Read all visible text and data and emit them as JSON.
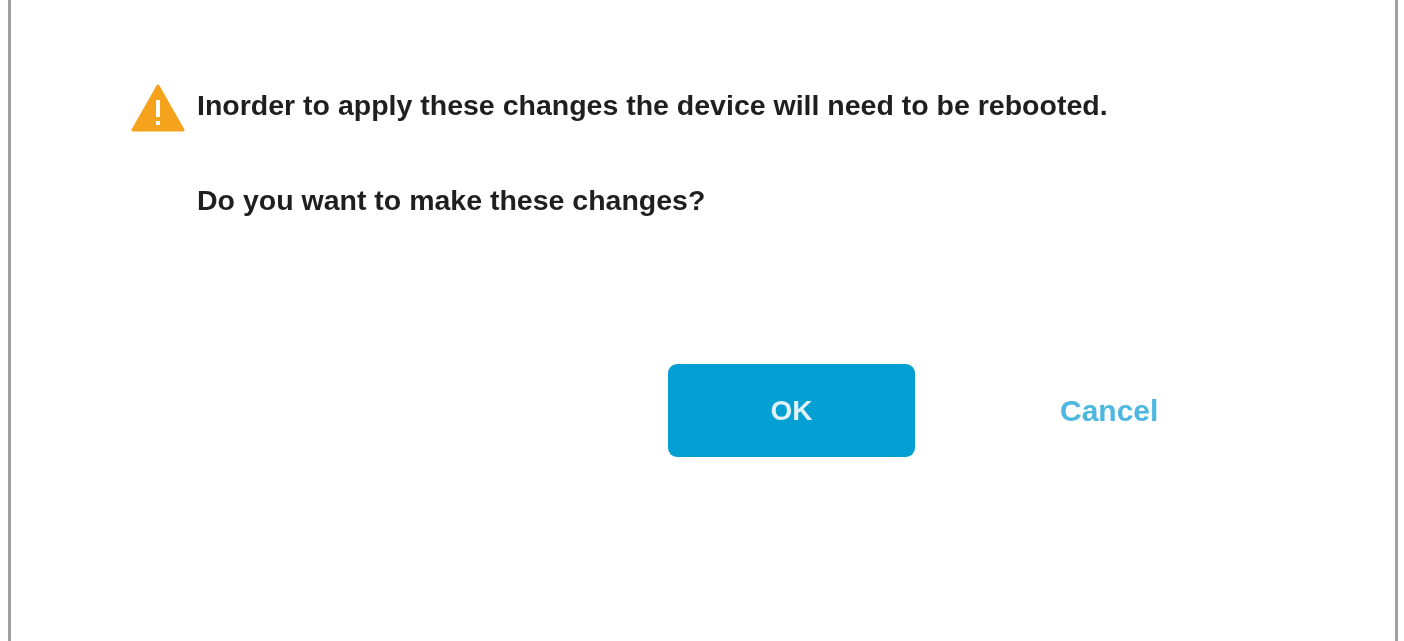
{
  "dialog": {
    "message": "Inorder to apply these changes the device will need to be rebooted.",
    "question": "Do you want to make these changes?",
    "buttons": [
      {
        "label": "OK",
        "kind": "primary"
      },
      {
        "label": "Cancel",
        "kind": "link"
      }
    ]
  }
}
